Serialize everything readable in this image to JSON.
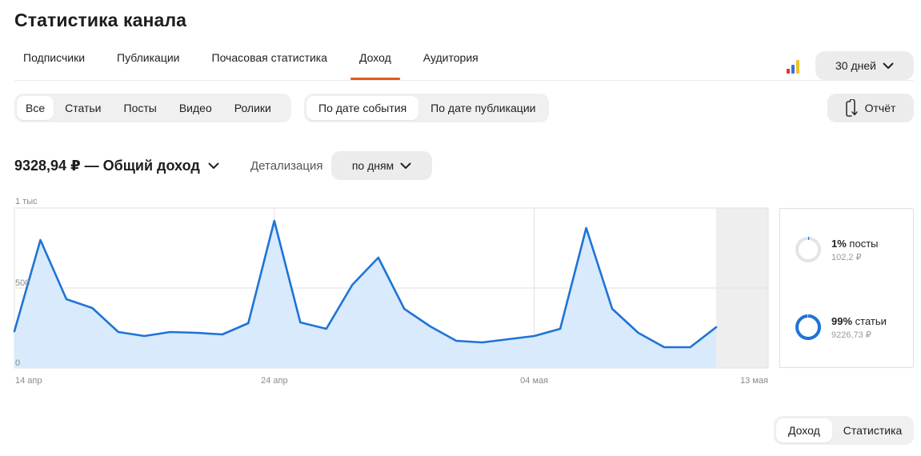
{
  "title": "Статистика канала",
  "tabs": [
    {
      "label": "Подписчики",
      "active": false
    },
    {
      "label": "Публикации",
      "active": false
    },
    {
      "label": "Почасовая статистика",
      "active": false
    },
    {
      "label": "Доход",
      "active": true
    },
    {
      "label": "Аудитория",
      "active": false
    }
  ],
  "period": {
    "label": "30 дней",
    "icon": "chevron-down-icon"
  },
  "bars_icon": {
    "colors": [
      "#e0342a",
      "#3d6ee0",
      "#f3c12a"
    ]
  },
  "content_filter": [
    {
      "label": "Все",
      "active": true
    },
    {
      "label": "Статьи",
      "active": false
    },
    {
      "label": "Посты",
      "active": false
    },
    {
      "label": "Видео",
      "active": false
    },
    {
      "label": "Ролики",
      "active": false
    }
  ],
  "date_filter": [
    {
      "label": "По дате события",
      "active": true
    },
    {
      "label": "По дате публикации",
      "active": false
    }
  ],
  "report_button": {
    "label": "Отчёт",
    "icon": "report-download-icon"
  },
  "total": {
    "label": "9328,94 ₽ — Общий доход",
    "icon": "chevron-down-icon"
  },
  "detail": {
    "label": "Детализация",
    "value": "по дням",
    "icon": "chevron-down-icon"
  },
  "chart_data": {
    "type": "area",
    "x": [
      "14 апр",
      "15 апр",
      "16 апр",
      "17 апр",
      "18 апр",
      "19 апр",
      "20 апр",
      "21 апр",
      "22 апр",
      "23 апр",
      "24 апр",
      "25 апр",
      "26 апр",
      "27 апр",
      "28 апр",
      "29 апр",
      "30 апр",
      "01 мая",
      "02 мая",
      "03 мая",
      "04 мая",
      "05 мая",
      "06 мая",
      "07 мая",
      "08 мая",
      "09 мая",
      "10 мая",
      "11 мая",
      "12 мая",
      "13 мая"
    ],
    "series": [
      {
        "values": [
          230,
          800,
          430,
          375,
          225,
          200,
          225,
          220,
          210,
          280,
          920,
          285,
          245,
          520,
          690,
          370,
          260,
          170,
          160,
          180,
          200,
          245,
          875,
          370,
          220,
          130,
          130,
          255
        ]
      }
    ],
    "y_ticks": [
      {
        "value": 1000,
        "label": "1 тыс"
      },
      {
        "value": 500,
        "label": "500"
      },
      {
        "value": 0,
        "label": "0"
      }
    ],
    "x_ticks": [
      {
        "index": 0,
        "label": "14 апр"
      },
      {
        "index": 10,
        "label": "24 апр"
      },
      {
        "index": 20,
        "label": "04 мая"
      },
      {
        "index": 29,
        "label": "13 мая"
      }
    ],
    "ylim": [
      0,
      1000
    ],
    "grid": true,
    "shaded_last_period": true,
    "line_color": "#1f73d6",
    "fill_color": "#d8eafb"
  },
  "legend": [
    {
      "percent": "1%",
      "name": "посты",
      "amount": "102,2 ₽",
      "fraction": 0.01
    },
    {
      "percent": "99%",
      "name": "статьи",
      "amount": "9226,73 ₽",
      "fraction": 0.99
    }
  ],
  "view_toggle": [
    {
      "label": "Доход",
      "active": true
    },
    {
      "label": "Статистика",
      "active": false
    }
  ]
}
